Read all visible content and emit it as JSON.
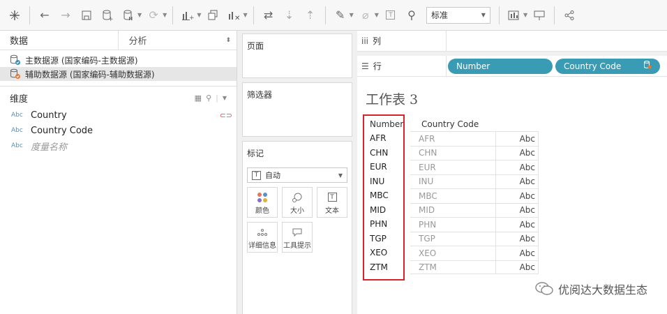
{
  "toolbar": {
    "fit_select": "标准"
  },
  "data_pane": {
    "tabs": {
      "data": "数据",
      "analysis": "分析"
    },
    "datasources": [
      {
        "label": "主数据源 (国家编码-主数据源)",
        "status": "primary"
      },
      {
        "label": "辅助数据源 (国家编码-辅助数据源)",
        "status": "secondary"
      }
    ],
    "dimensions_title": "维度",
    "fields": [
      {
        "type": "Abc",
        "label": "Country",
        "linked": true
      },
      {
        "type": "Abc",
        "label": "Country Code",
        "linked": false
      },
      {
        "type": "Abc",
        "label": "度量名称",
        "linked": false
      }
    ]
  },
  "mid_pane": {
    "pages_title": "页面",
    "filters_title": "筛选器",
    "marks_title": "标记",
    "marks_type": "自动",
    "marks_buttons": [
      {
        "label": "颜色",
        "icon": "color-icon"
      },
      {
        "label": "大小",
        "icon": "size-icon"
      },
      {
        "label": "文本",
        "icon": "text-icon"
      },
      {
        "label": "详细信息",
        "icon": "detail-icon"
      },
      {
        "label": "工具提示",
        "icon": "tooltip-icon"
      }
    ]
  },
  "shelves": {
    "columns_label": "列",
    "rows_label": "行",
    "row_pills": [
      "Number",
      "Country Code"
    ]
  },
  "worksheet": {
    "title": "工作表 3",
    "headers": [
      "Number",
      "Country Code"
    ],
    "rows": [
      {
        "number": "AFR",
        "code": "AFR",
        "value": "Abc"
      },
      {
        "number": "CHN",
        "code": "CHN",
        "value": "Abc"
      },
      {
        "number": "EUR",
        "code": "EUR",
        "value": "Abc"
      },
      {
        "number": "INU",
        "code": "INU",
        "value": "Abc"
      },
      {
        "number": "MBC",
        "code": "MBC",
        "value": "Abc"
      },
      {
        "number": "MID",
        "code": "MID",
        "value": "Abc"
      },
      {
        "number": "PHN",
        "code": "PHN",
        "value": "Abc"
      },
      {
        "number": "TGP",
        "code": "TGP",
        "value": "Abc"
      },
      {
        "number": "XEO",
        "code": "XEO",
        "value": "Abc"
      },
      {
        "number": "ZTM",
        "code": "ZTM",
        "value": "Abc"
      }
    ]
  },
  "watermark": "优阅达大数据生态",
  "colors": {
    "pill": "#3a9bb5",
    "highlight": "#d9222a",
    "link": "#e04848"
  }
}
